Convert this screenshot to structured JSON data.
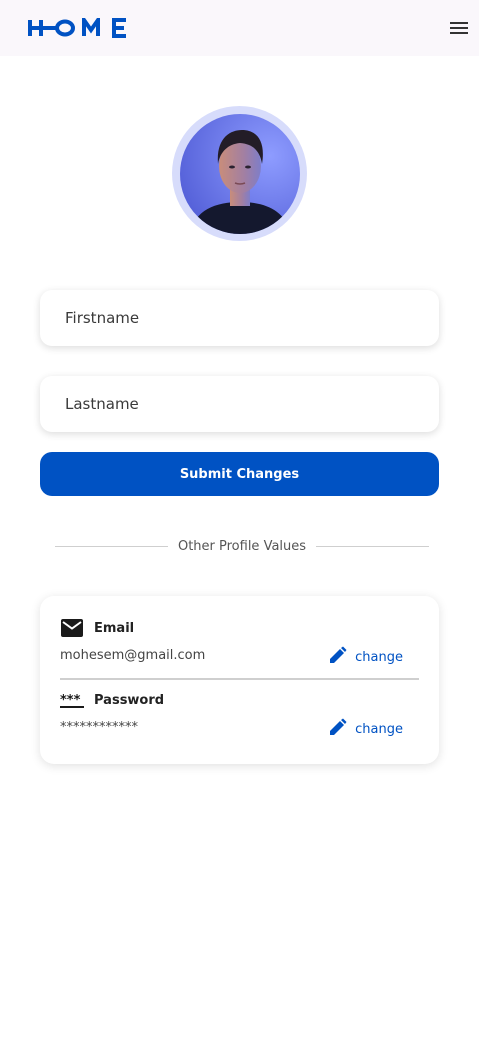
{
  "header": {
    "logo_text": "HOME",
    "logo_icon": "home-wordmark-logo",
    "menu_icon": "hamburger-menu-icon"
  },
  "profile": {
    "avatar_icon": "user-avatar-photo"
  },
  "form": {
    "firstname_placeholder": "Firstname",
    "lastname_placeholder": "Lastname",
    "submit_label": "Submit Changes"
  },
  "divider": {
    "label": "Other Profile Values"
  },
  "email": {
    "icon": "mail-icon",
    "label": "Email",
    "value": "mohesem@gmail.com",
    "change_icon": "pencil-icon",
    "change_label": "change"
  },
  "password": {
    "icon": "password-icon",
    "label": "Password",
    "value": "************",
    "change_icon": "pencil-icon",
    "change_label": "change"
  },
  "colors": {
    "primary": "#0052c3",
    "topbar_bg": "#faf7fb",
    "avatar_ring": "#d7dcfb"
  }
}
